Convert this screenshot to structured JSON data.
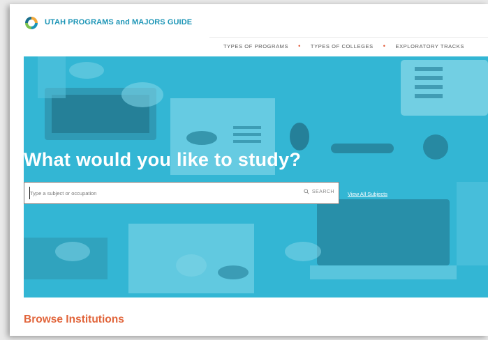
{
  "header": {
    "site_title": "UTAH PROGRAMS and MAJORS GUIDE",
    "logo_icon": "swirl-logo-icon"
  },
  "nav": {
    "items": [
      {
        "label": "TYPES OF PROGRAMS"
      },
      {
        "label": "TYPES OF COLLEGES"
      },
      {
        "label": "EXPLORATORY TRACKS"
      }
    ],
    "separator": "•"
  },
  "hero": {
    "title": "What would you like to study?",
    "search_placeholder": "Type a subject or occupation",
    "search_value": "",
    "search_button_label": "SEARCH",
    "search_icon": "magnifier-icon",
    "view_all_link": "View All Subjects"
  },
  "browse_heading": "Browse Institutions",
  "colors": {
    "brand_blue": "#1c95b6",
    "hero_overlay": "#33b6d4",
    "accent_orange": "#e1643a",
    "nav_dot": "#e1522f"
  }
}
